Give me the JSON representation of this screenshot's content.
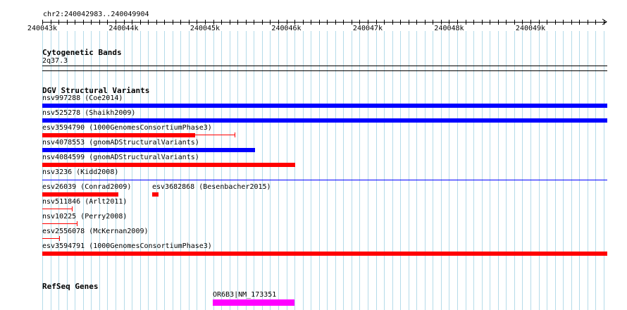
{
  "location": "chr2:240042983..240049904",
  "ruler": {
    "labels": [
      "240043k",
      "240044k",
      "240045k",
      "240046k",
      "240047k",
      "240048k",
      "240049k"
    ]
  },
  "tracks": {
    "cytobands": {
      "title": "Cytogenetic Bands",
      "band": "2q37.3"
    },
    "dgv": {
      "title": "DGV Structural Variants",
      "features": [
        {
          "label": "nsv997288 (Coe2014)",
          "color": "#0000ff"
        },
        {
          "label": "nsv525278 (Shaikh2009)",
          "color": "#0000ff"
        },
        {
          "label": "esv3594790 (1000GenomesConsortiumPhase3)",
          "color": "#ff0000"
        },
        {
          "label": "nsv4078553 (gnomADStructuralVariants)",
          "color": "#0000ff"
        },
        {
          "label": "nsv4084599 (gnomADStructuralVariants)",
          "color": "#ff0000"
        },
        {
          "label": "nsv3236 (Kidd2008)",
          "color": "#0000ff"
        },
        {
          "label": "esv26039 (Conrad2009)",
          "color": "#ff0000"
        },
        {
          "label": "esv3682868 (Besenbacher2015)",
          "color": "#ff0000"
        },
        {
          "label": "nsv511846 (Arlt2011)",
          "color": "#ff0000"
        },
        {
          "label": "nsv10225 (Perry2008)",
          "color": "#ff0000"
        },
        {
          "label": "esv2556078 (McKernan2009)",
          "color": "#ff0000"
        },
        {
          "label": "esv3594791 (1000GenomesConsortiumPhase3)",
          "color": "#ff0000"
        }
      ]
    },
    "refseq": {
      "title": "RefSeq Genes",
      "gene": {
        "label": "OR6B3|NM_173351",
        "color": "#ff00ff"
      }
    }
  }
}
